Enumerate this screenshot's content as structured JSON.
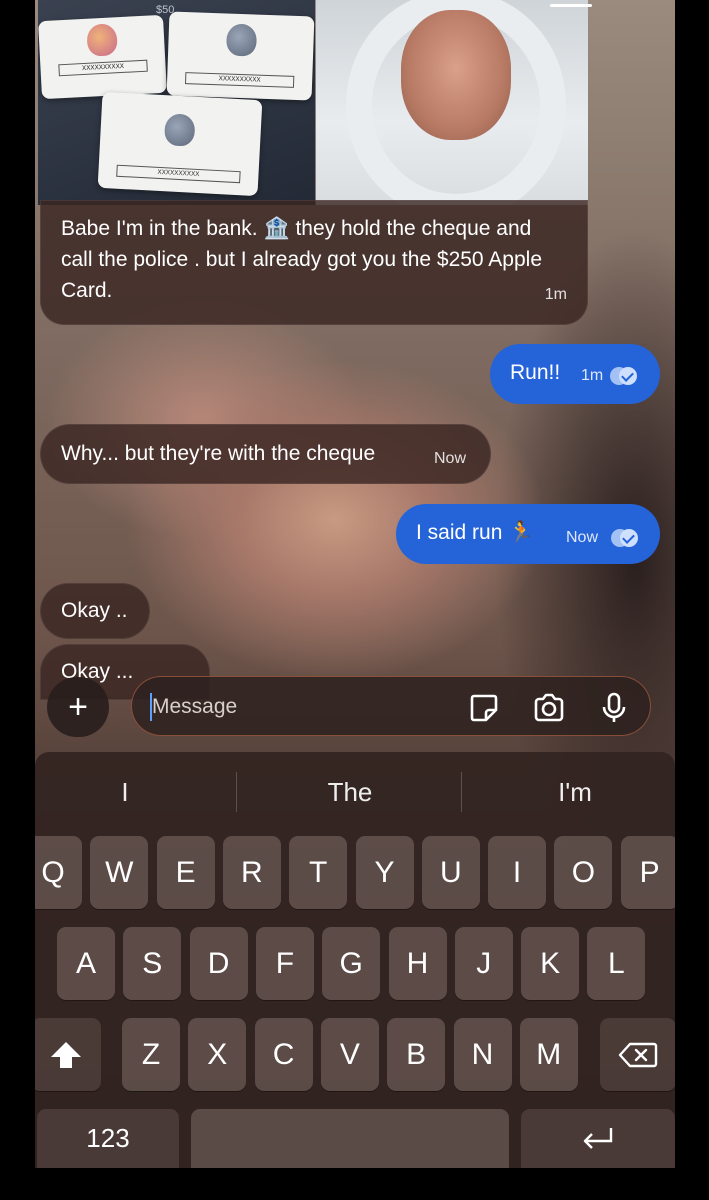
{
  "photos": {
    "price_tag": "$50"
  },
  "messages": [
    {
      "dir": "in",
      "text": "Babe I'm in the bank. 🏦 they hold the cheque and call the police . but I already got you the $250 Apple Card.",
      "time": "1m"
    },
    {
      "dir": "out",
      "text": "Run!!",
      "time": "1m"
    },
    {
      "dir": "in",
      "text": "Why... but they're with the cheque",
      "time": "Now"
    },
    {
      "dir": "out",
      "text": "I said run 🏃",
      "time": "Now"
    },
    {
      "dir": "in",
      "text": "Okay .."
    },
    {
      "dir": "in",
      "text": "Okay ..."
    }
  ],
  "composer": {
    "placeholder": "Message",
    "plus": "+"
  },
  "keyboard": {
    "suggestions": [
      "I",
      "The",
      "I'm"
    ],
    "row1": [
      "Q",
      "W",
      "E",
      "R",
      "T",
      "Y",
      "U",
      "I",
      "O",
      "P"
    ],
    "row2": [
      "A",
      "S",
      "D",
      "F",
      "G",
      "H",
      "J",
      "K",
      "L"
    ],
    "row3": [
      "Z",
      "X",
      "C",
      "V",
      "B",
      "N",
      "M"
    ],
    "numbers_key": "123"
  },
  "colors": {
    "outgoing": "#2563d9",
    "incoming": "#3a2622"
  }
}
